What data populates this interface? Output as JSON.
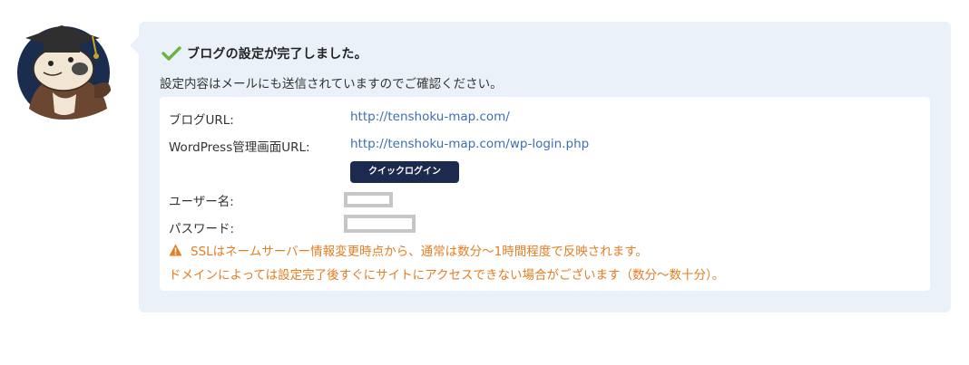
{
  "message": {
    "title": "ブログの設定が完了しました。",
    "note": "設定内容はメールにも送信されていますのでご確認ください。"
  },
  "details": {
    "blog_url_label": "ブログURL:",
    "blog_url": "http://tenshoku-map.com/",
    "admin_url_label": "WordPress管理画面URL:",
    "admin_url": "http://tenshoku-map.com/wp-login.php",
    "quick_login_label": "クイックログイン",
    "username_label": "ユーザー名:",
    "password_label": "パスワード:"
  },
  "notice": {
    "line1": "SSLはネームサーバー情報変更時点から、通常は数分〜1時間程度で反映されます。",
    "line2": "ドメインによっては設定完了後すぐにサイトにアクセスできない場合がございます（数分〜数十分）。"
  },
  "icons": {
    "success": "check-icon",
    "warning": "warning-icon",
    "avatar": "otter-graduate-avatar"
  },
  "colors": {
    "bubble_bg": "#eaf1f8",
    "link": "#3b6fb6",
    "button_bg": "#1c2a4e",
    "check": "#6cb33f",
    "warning": "#e37e22"
  }
}
